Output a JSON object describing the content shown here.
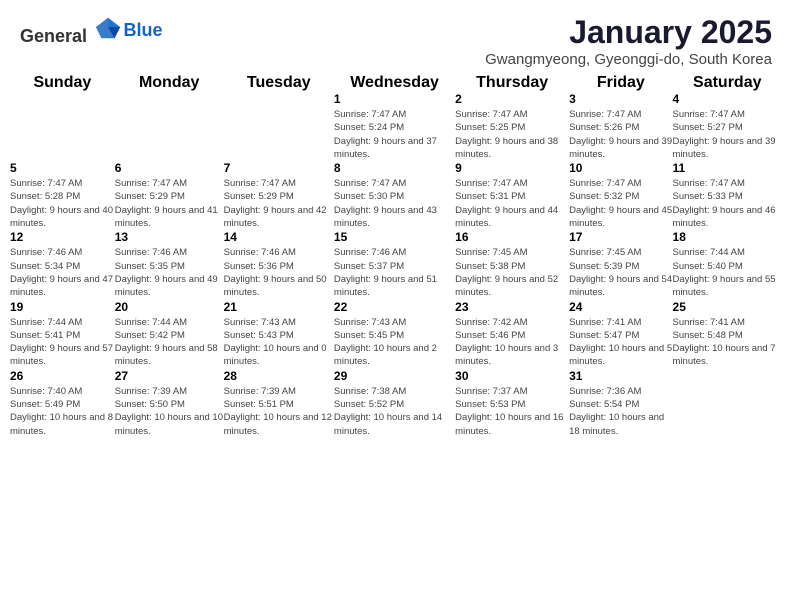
{
  "header": {
    "logo_general": "General",
    "logo_blue": "Blue",
    "month_year": "January 2025",
    "location": "Gwangmyeong, Gyeonggi-do, South Korea"
  },
  "weekdays": [
    "Sunday",
    "Monday",
    "Tuesday",
    "Wednesday",
    "Thursday",
    "Friday",
    "Saturday"
  ],
  "weeks": [
    [
      {
        "day": "",
        "info": ""
      },
      {
        "day": "",
        "info": ""
      },
      {
        "day": "",
        "info": ""
      },
      {
        "day": "1",
        "info": "Sunrise: 7:47 AM\nSunset: 5:24 PM\nDaylight: 9 hours and 37 minutes."
      },
      {
        "day": "2",
        "info": "Sunrise: 7:47 AM\nSunset: 5:25 PM\nDaylight: 9 hours and 38 minutes."
      },
      {
        "day": "3",
        "info": "Sunrise: 7:47 AM\nSunset: 5:26 PM\nDaylight: 9 hours and 39 minutes."
      },
      {
        "day": "4",
        "info": "Sunrise: 7:47 AM\nSunset: 5:27 PM\nDaylight: 9 hours and 39 minutes."
      }
    ],
    [
      {
        "day": "5",
        "info": "Sunrise: 7:47 AM\nSunset: 5:28 PM\nDaylight: 9 hours and 40 minutes."
      },
      {
        "day": "6",
        "info": "Sunrise: 7:47 AM\nSunset: 5:29 PM\nDaylight: 9 hours and 41 minutes."
      },
      {
        "day": "7",
        "info": "Sunrise: 7:47 AM\nSunset: 5:29 PM\nDaylight: 9 hours and 42 minutes."
      },
      {
        "day": "8",
        "info": "Sunrise: 7:47 AM\nSunset: 5:30 PM\nDaylight: 9 hours and 43 minutes."
      },
      {
        "day": "9",
        "info": "Sunrise: 7:47 AM\nSunset: 5:31 PM\nDaylight: 9 hours and 44 minutes."
      },
      {
        "day": "10",
        "info": "Sunrise: 7:47 AM\nSunset: 5:32 PM\nDaylight: 9 hours and 45 minutes."
      },
      {
        "day": "11",
        "info": "Sunrise: 7:47 AM\nSunset: 5:33 PM\nDaylight: 9 hours and 46 minutes."
      }
    ],
    [
      {
        "day": "12",
        "info": "Sunrise: 7:46 AM\nSunset: 5:34 PM\nDaylight: 9 hours and 47 minutes."
      },
      {
        "day": "13",
        "info": "Sunrise: 7:46 AM\nSunset: 5:35 PM\nDaylight: 9 hours and 49 minutes."
      },
      {
        "day": "14",
        "info": "Sunrise: 7:46 AM\nSunset: 5:36 PM\nDaylight: 9 hours and 50 minutes."
      },
      {
        "day": "15",
        "info": "Sunrise: 7:46 AM\nSunset: 5:37 PM\nDaylight: 9 hours and 51 minutes."
      },
      {
        "day": "16",
        "info": "Sunrise: 7:45 AM\nSunset: 5:38 PM\nDaylight: 9 hours and 52 minutes."
      },
      {
        "day": "17",
        "info": "Sunrise: 7:45 AM\nSunset: 5:39 PM\nDaylight: 9 hours and 54 minutes."
      },
      {
        "day": "18",
        "info": "Sunrise: 7:44 AM\nSunset: 5:40 PM\nDaylight: 9 hours and 55 minutes."
      }
    ],
    [
      {
        "day": "19",
        "info": "Sunrise: 7:44 AM\nSunset: 5:41 PM\nDaylight: 9 hours and 57 minutes."
      },
      {
        "day": "20",
        "info": "Sunrise: 7:44 AM\nSunset: 5:42 PM\nDaylight: 9 hours and 58 minutes."
      },
      {
        "day": "21",
        "info": "Sunrise: 7:43 AM\nSunset: 5:43 PM\nDaylight: 10 hours and 0 minutes."
      },
      {
        "day": "22",
        "info": "Sunrise: 7:43 AM\nSunset: 5:45 PM\nDaylight: 10 hours and 2 minutes."
      },
      {
        "day": "23",
        "info": "Sunrise: 7:42 AM\nSunset: 5:46 PM\nDaylight: 10 hours and 3 minutes."
      },
      {
        "day": "24",
        "info": "Sunrise: 7:41 AM\nSunset: 5:47 PM\nDaylight: 10 hours and 5 minutes."
      },
      {
        "day": "25",
        "info": "Sunrise: 7:41 AM\nSunset: 5:48 PM\nDaylight: 10 hours and 7 minutes."
      }
    ],
    [
      {
        "day": "26",
        "info": "Sunrise: 7:40 AM\nSunset: 5:49 PM\nDaylight: 10 hours and 8 minutes."
      },
      {
        "day": "27",
        "info": "Sunrise: 7:39 AM\nSunset: 5:50 PM\nDaylight: 10 hours and 10 minutes."
      },
      {
        "day": "28",
        "info": "Sunrise: 7:39 AM\nSunset: 5:51 PM\nDaylight: 10 hours and 12 minutes."
      },
      {
        "day": "29",
        "info": "Sunrise: 7:38 AM\nSunset: 5:52 PM\nDaylight: 10 hours and 14 minutes."
      },
      {
        "day": "30",
        "info": "Sunrise: 7:37 AM\nSunset: 5:53 PM\nDaylight: 10 hours and 16 minutes."
      },
      {
        "day": "31",
        "info": "Sunrise: 7:36 AM\nSunset: 5:54 PM\nDaylight: 10 hours and 18 minutes."
      },
      {
        "day": "",
        "info": ""
      }
    ]
  ]
}
